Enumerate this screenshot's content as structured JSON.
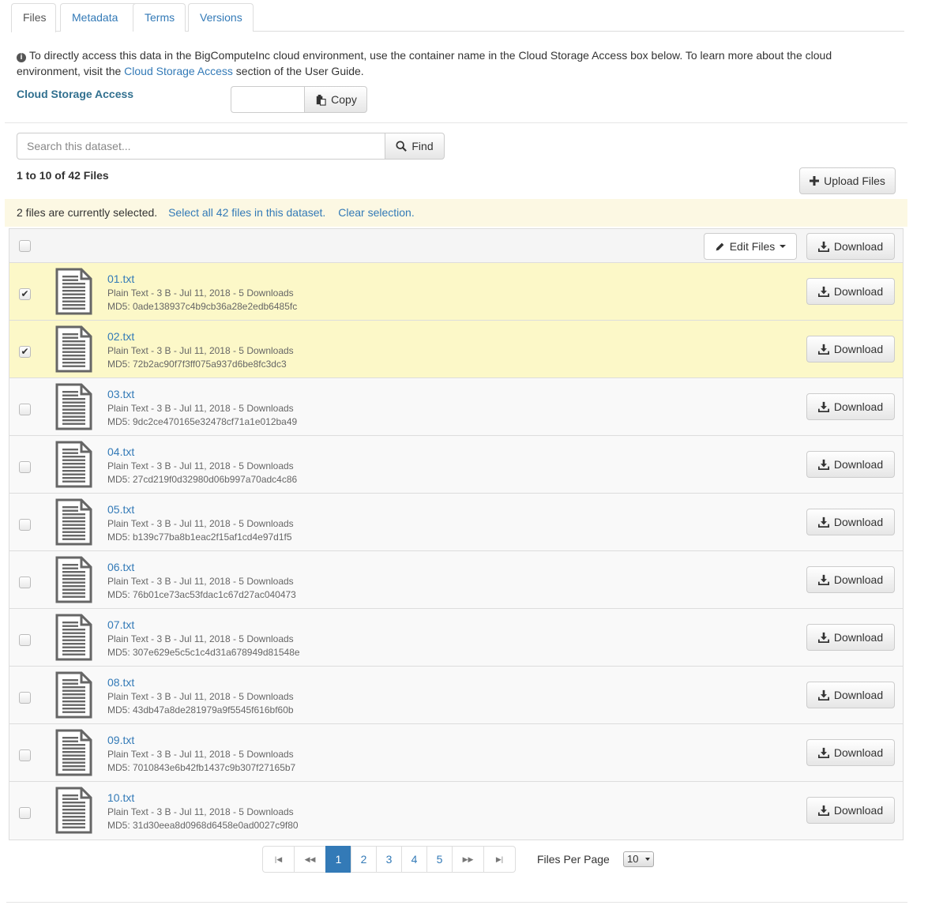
{
  "tabs": [
    {
      "label": "Files",
      "active": true
    },
    {
      "label": "Metadata",
      "active": false
    },
    {
      "label": "Terms",
      "active": false
    },
    {
      "label": "Versions",
      "active": false
    }
  ],
  "info": {
    "text_before_link": "To directly access this data in the BigComputeInc cloud environment, use the container name in the Cloud Storage Access box below. To learn more about the cloud environment, visit the ",
    "link": "Cloud Storage Access",
    "text_after_link": " section of the User Guide."
  },
  "cloud_storage": {
    "label": "Cloud Storage Access",
    "input_value": "",
    "copy_label": "Copy"
  },
  "search": {
    "placeholder": "Search this dataset...",
    "button_label": "Find"
  },
  "count_text": "1 to 10 of 42 Files",
  "upload_label": "Upload Files",
  "selection": {
    "message": "2 files are currently selected.",
    "select_all": "Select all 42 files in this dataset.",
    "clear": "Clear selection."
  },
  "table_header": {
    "edit_label": "Edit Files",
    "download_label": "Download"
  },
  "files": [
    {
      "name": "01.txt",
      "meta": "Plain Text - 3 B - Jul 11, 2018 - 5 Downloads",
      "md5": "MD5: 0ade138937c4b9cb36a28e2edb6485fc",
      "selected": true,
      "download": "Download"
    },
    {
      "name": "02.txt",
      "meta": "Plain Text - 3 B - Jul 11, 2018 - 5 Downloads",
      "md5": "MD5: 72b2ac90f7f3ff075a937d6be8fc3dc3",
      "selected": true,
      "download": "Download"
    },
    {
      "name": "03.txt",
      "meta": "Plain Text - 3 B - Jul 11, 2018 - 5 Downloads",
      "md5": "MD5: 9dc2ce470165e32478cf71a1e012ba49",
      "selected": false,
      "download": "Download"
    },
    {
      "name": "04.txt",
      "meta": "Plain Text - 3 B - Jul 11, 2018 - 5 Downloads",
      "md5": "MD5: 27cd219f0d32980d06b997a70adc4c86",
      "selected": false,
      "download": "Download"
    },
    {
      "name": "05.txt",
      "meta": "Plain Text - 3 B - Jul 11, 2018 - 5 Downloads",
      "md5": "MD5: b139c77ba8b1eac2f15af1cd4e97d1f5",
      "selected": false,
      "download": "Download"
    },
    {
      "name": "06.txt",
      "meta": "Plain Text - 3 B - Jul 11, 2018 - 5 Downloads",
      "md5": "MD5: 76b01ce73ac53fdac1c67d27ac040473",
      "selected": false,
      "download": "Download"
    },
    {
      "name": "07.txt",
      "meta": "Plain Text - 3 B - Jul 11, 2018 - 5 Downloads",
      "md5": "MD5: 307e629e5c5c1c4d31a678949d81548e",
      "selected": false,
      "download": "Download"
    },
    {
      "name": "08.txt",
      "meta": "Plain Text - 3 B - Jul 11, 2018 - 5 Downloads",
      "md5": "MD5: 43db47a8de281979a9f5545f616bf60b",
      "selected": false,
      "download": "Download"
    },
    {
      "name": "09.txt",
      "meta": "Plain Text - 3 B - Jul 11, 2018 - 5 Downloads",
      "md5": "MD5: 7010843e6b42fb1437c9b307f27165b7",
      "selected": false,
      "download": "Download"
    },
    {
      "name": "10.txt",
      "meta": "Plain Text - 3 B - Jul 11, 2018 - 5 Downloads",
      "md5": "MD5: 31d30eea8d0968d6458e0ad0027c9f80",
      "selected": false,
      "download": "Download"
    }
  ],
  "pagination": {
    "first": "|◀",
    "prev": "◀◀",
    "pages": [
      "1",
      "2",
      "3",
      "4",
      "5"
    ],
    "current": "1",
    "next": "▶▶",
    "last": "▶|"
  },
  "files_per_page": {
    "label": "Files Per Page",
    "value": "10"
  },
  "icons": {
    "info": "info-circle-icon",
    "copy": "clipboard-icon",
    "find": "search-icon",
    "upload": "plus-icon",
    "edit": "pencil-icon",
    "download": "download-icon",
    "file": "text-file-icon"
  },
  "colors": {
    "link": "#337ab7",
    "selection_bar": "#fcf8e3",
    "selected_row": "#fcf8c8",
    "label_blue": "#31708f"
  }
}
